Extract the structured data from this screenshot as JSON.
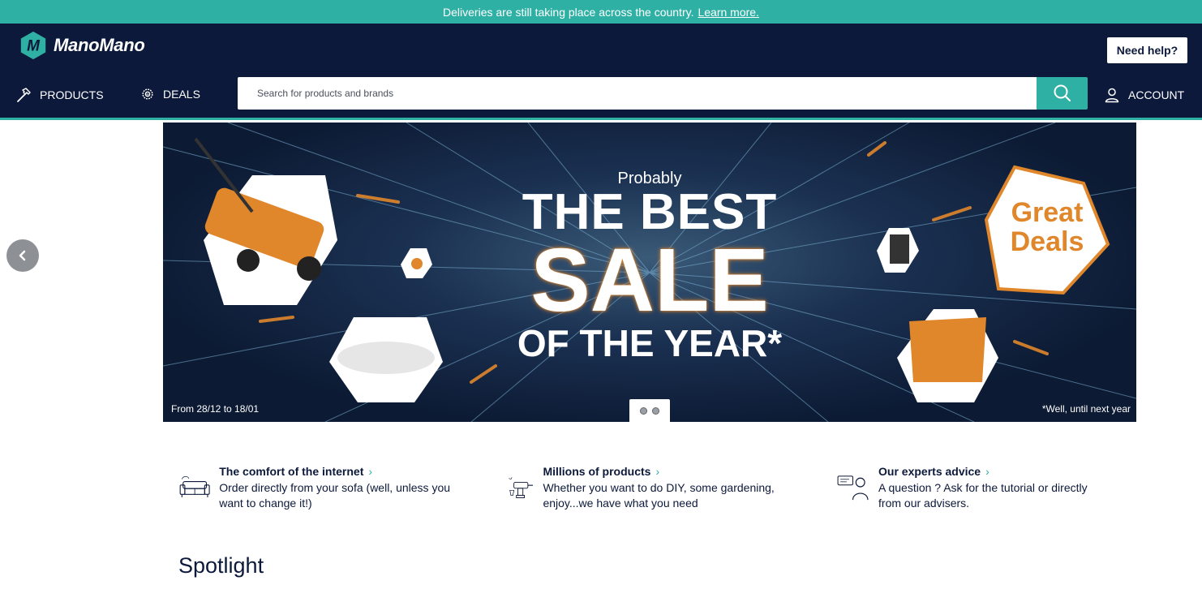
{
  "announcement": {
    "text": "Deliveries are still taking place across the country.",
    "link": "Learn more."
  },
  "header": {
    "logo_text": "ManoMano",
    "help_label": "Need help?",
    "nav": {
      "products": "PRODUCTS",
      "deals": "DEALS",
      "account": "ACCOUNT"
    },
    "search": {
      "placeholder": "Search for products and brands",
      "value": ""
    }
  },
  "banner": {
    "kicker": "Probably",
    "line1": "THE BEST",
    "line2": "SALE",
    "line3": "OF THE YEAR*",
    "badge_line1": "Great",
    "badge_line2": "Deals",
    "dates": "From 28/12 to 18/01",
    "footnote": "*Well, until next year"
  },
  "features": [
    {
      "title": "The comfort of the internet",
      "description": "Order directly from your sofa (well, unless you want to change it!)",
      "icon": "sofa-icon"
    },
    {
      "title": "Millions of products",
      "description": "Whether you want to do DIY, some gardening, enjoy...we have what you need",
      "icon": "drill-icon"
    },
    {
      "title": "Our experts advice",
      "description": "A question ? Ask for the tutorial or directly from our advisers.",
      "icon": "advisor-icon"
    }
  ],
  "spotlight_title": "Spotlight",
  "colors": {
    "brand_teal": "#2fb0a5",
    "navy": "#0c193a",
    "orange": "#e0862b"
  }
}
